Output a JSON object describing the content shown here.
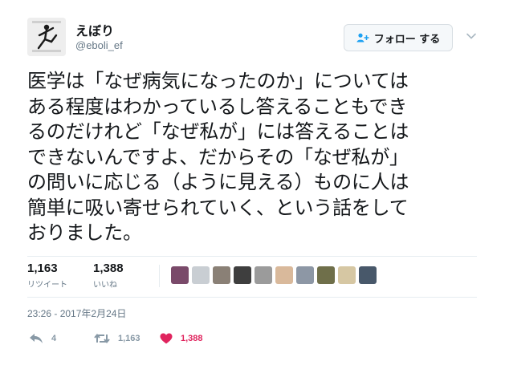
{
  "author": {
    "display_name": "えぼり",
    "username": "@eboli_ef",
    "avatar_icon": "avatar-photo-icon"
  },
  "follow_button": {
    "label": "フォロー する",
    "icon": "follow-user-plus-icon"
  },
  "menu": {
    "icon": "chevron-down-icon"
  },
  "tweet": {
    "lines": [
      "医学は「なぜ病気になったのか」については",
      "ある程度はわかっているし答えることもでき",
      "るのだけれど「なぜ私が」には答えることは",
      "できないんですよ、だからその「なぜ私が」",
      "の問いに応じる（ように見える）ものに人は",
      "簡単に吸い寄せられていく、という話をして",
      "おりました。"
    ]
  },
  "stats": {
    "retweets": {
      "count": "1,163",
      "label": "リツイート"
    },
    "likes": {
      "count": "1,388",
      "label": "いいね"
    }
  },
  "likers": {
    "colors": [
      "#7a4a6a",
      "#c9ced3",
      "#8a8076",
      "#3e3e3e",
      "#9b9b9b",
      "#d9b99b",
      "#8d97a5",
      "#6f6f4a",
      "#d6c7a3",
      "#48586a"
    ]
  },
  "timestamp": "23:26 - 2017年2月24日",
  "actions": {
    "reply": {
      "count": "4",
      "icon": "reply-icon"
    },
    "retweet": {
      "count": "1,163",
      "icon": "retweet-icon"
    },
    "like": {
      "count": "1,388",
      "icon": "heart-icon"
    }
  },
  "colors": {
    "text": "#14171a",
    "secondary": "#657786",
    "action_gray": "#8899a6",
    "like_red": "#e0245e",
    "divider": "#e6ecf0"
  }
}
